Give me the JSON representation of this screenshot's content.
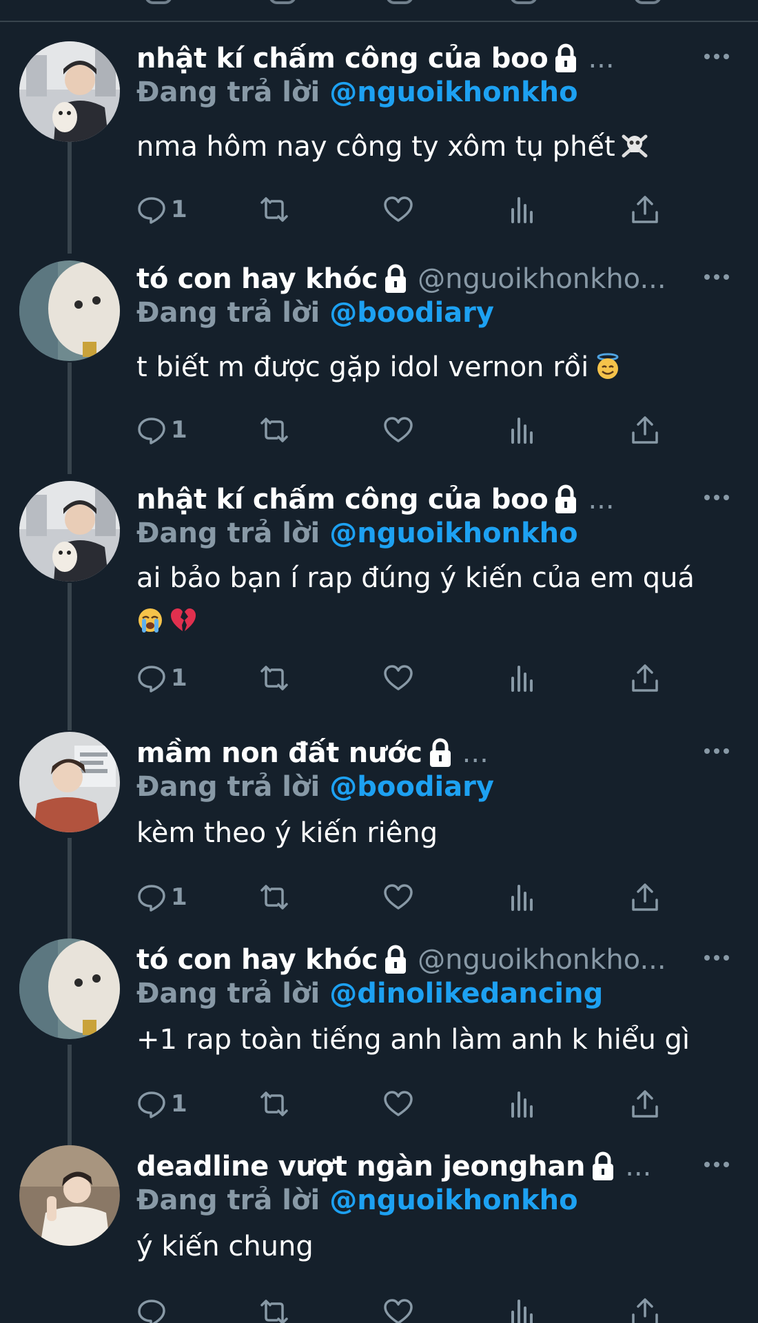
{
  "colors": {
    "background": "#15202b",
    "divider": "#38444d",
    "muted": "#8899a6",
    "accent": "#1da1f2",
    "text": "#ffffff"
  },
  "icons": {
    "reply": "reply-icon",
    "retweet": "retweet-icon",
    "like": "heart-icon",
    "analytics": "analytics-icon",
    "share": "share-icon",
    "more": "more-horizontal-icon",
    "protected": "lock-icon"
  },
  "tweets": [
    {
      "name": "nhật kí chấm công của boo",
      "handle": "...",
      "reply_prefix": "Đang trả lời",
      "reply_to": "@nguoikhonkho",
      "text": "nma hôm nay công ty xôm tụ phết",
      "emoji": "skull-crossbones",
      "reply_count": "1"
    },
    {
      "name": "tó con hay khóc",
      "handle": "@nguoikhonkho...",
      "reply_prefix": "Đang trả lời",
      "reply_to": "@boodiary",
      "text": "t biết m được gặp idol vernon rồi",
      "emoji": "smiling-face-with-halo",
      "reply_count": "1"
    },
    {
      "name": "nhật kí chấm công của boo",
      "handle": "...",
      "reply_prefix": "Đang trả lời",
      "reply_to": "@nguoikhonkho",
      "text": "ai bảo bạn í rap đúng ý kiến của em quá",
      "emoji": "loudly-crying-face broken-heart",
      "reply_count": "1"
    },
    {
      "name": "mầm non đất nước",
      "handle": "...",
      "reply_prefix": "Đang trả lời",
      "reply_to": "@boodiary",
      "text": "kèm theo ý kiến riêng",
      "reply_count": "1"
    },
    {
      "name": "tó con hay khóc",
      "handle": "@nguoikhonkho...",
      "reply_prefix": "Đang trả lời",
      "reply_to": "@dinolikedancing",
      "text": "+1 rap toàn tiếng anh làm anh k hiểu gì",
      "reply_count": "1"
    },
    {
      "name": "deadline vượt ngàn jeonghan",
      "handle": "...",
      "reply_prefix": "Đang trả lời",
      "reply_to": "@nguoikhonkho",
      "text": "ý kiến chung",
      "reply_count": ""
    }
  ]
}
